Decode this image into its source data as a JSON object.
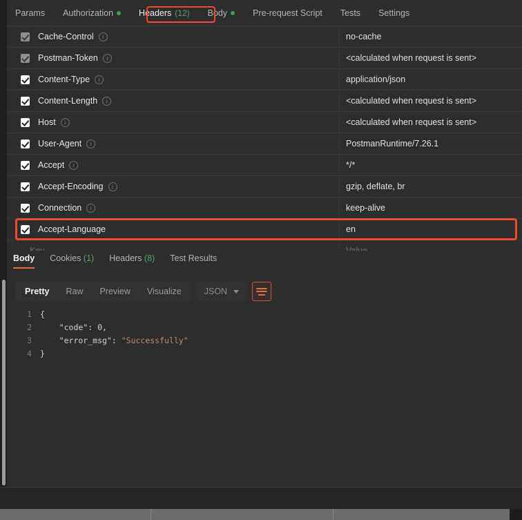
{
  "request_tabs": [
    {
      "label": "Params",
      "active": false,
      "dot": false,
      "count": ""
    },
    {
      "label": "Authorization",
      "active": false,
      "dot": true,
      "count": ""
    },
    {
      "label": "Headers",
      "active": true,
      "dot": false,
      "count": "(12)"
    },
    {
      "label": "Body",
      "active": false,
      "dot": true,
      "count": ""
    },
    {
      "label": "Pre-request Script",
      "active": false,
      "dot": false,
      "count": ""
    },
    {
      "label": "Tests",
      "active": false,
      "dot": false,
      "count": ""
    },
    {
      "label": "Settings",
      "active": false,
      "dot": false,
      "count": ""
    }
  ],
  "headers_table": {
    "key_placeholder": "Key",
    "value_placeholder": "Value",
    "rows": [
      {
        "checked": true,
        "dim": true,
        "info": true,
        "key": "Cache-Control",
        "value": "no-cache"
      },
      {
        "checked": true,
        "dim": true,
        "info": true,
        "key": "Postman-Token",
        "value": "<calculated when request is sent>"
      },
      {
        "checked": true,
        "dim": false,
        "info": true,
        "key": "Content-Type",
        "value": "application/json"
      },
      {
        "checked": true,
        "dim": false,
        "info": true,
        "key": "Content-Length",
        "value": "<calculated when request is sent>"
      },
      {
        "checked": true,
        "dim": false,
        "info": true,
        "key": "Host",
        "value": "<calculated when request is sent>"
      },
      {
        "checked": true,
        "dim": false,
        "info": true,
        "key": "User-Agent",
        "value": "PostmanRuntime/7.26.1"
      },
      {
        "checked": true,
        "dim": false,
        "info": true,
        "key": "Accept",
        "value": "*/*"
      },
      {
        "checked": true,
        "dim": false,
        "info": true,
        "key": "Accept-Encoding",
        "value": "gzip, deflate, br"
      },
      {
        "checked": true,
        "dim": false,
        "info": true,
        "key": "Connection",
        "value": "keep-alive"
      },
      {
        "checked": true,
        "dim": false,
        "info": false,
        "key": "Accept-Language",
        "value": "en"
      }
    ]
  },
  "response_tabs": [
    {
      "label": "Body",
      "count": "",
      "active": true
    },
    {
      "label": "Cookies",
      "count": "(1)",
      "active": false
    },
    {
      "label": "Headers",
      "count": "(8)",
      "active": false
    },
    {
      "label": "Test Results",
      "count": "",
      "active": false
    }
  ],
  "format_bar": {
    "modes": [
      {
        "label": "Pretty",
        "active": true
      },
      {
        "label": "Raw",
        "active": false
      },
      {
        "label": "Preview",
        "active": false
      },
      {
        "label": "Visualize",
        "active": false
      }
    ],
    "language": "JSON",
    "wrap_icon": "word-wrap-icon"
  },
  "response_body": {
    "lines": [
      {
        "n": "1",
        "parts": [
          {
            "t": "{",
            "c": "k-punc"
          }
        ]
      },
      {
        "n": "2",
        "parts": [
          {
            "t": "    \"code\"",
            "c": "k-key"
          },
          {
            "t": ": ",
            "c": "k-punc"
          },
          {
            "t": "0",
            "c": "k-num"
          },
          {
            "t": ",",
            "c": "k-punc"
          }
        ]
      },
      {
        "n": "3",
        "parts": [
          {
            "t": "    \"error_msg\"",
            "c": "k-key"
          },
          {
            "t": ": ",
            "c": "k-punc"
          },
          {
            "t": "\"Successfully\"",
            "c": "k-str"
          }
        ]
      },
      {
        "n": "4",
        "parts": [
          {
            "t": "}",
            "c": "k-punc"
          }
        ]
      }
    ]
  },
  "highlights": {
    "headers_tab": "red-highlight-headers-tab",
    "accept_language_row": "red-highlight-accept-language-row"
  },
  "colors": {
    "accent_orange": "#e8703a",
    "highlight_red": "#f0492f",
    "status_green": "#3f9c52",
    "background": "#2d2d2d"
  }
}
